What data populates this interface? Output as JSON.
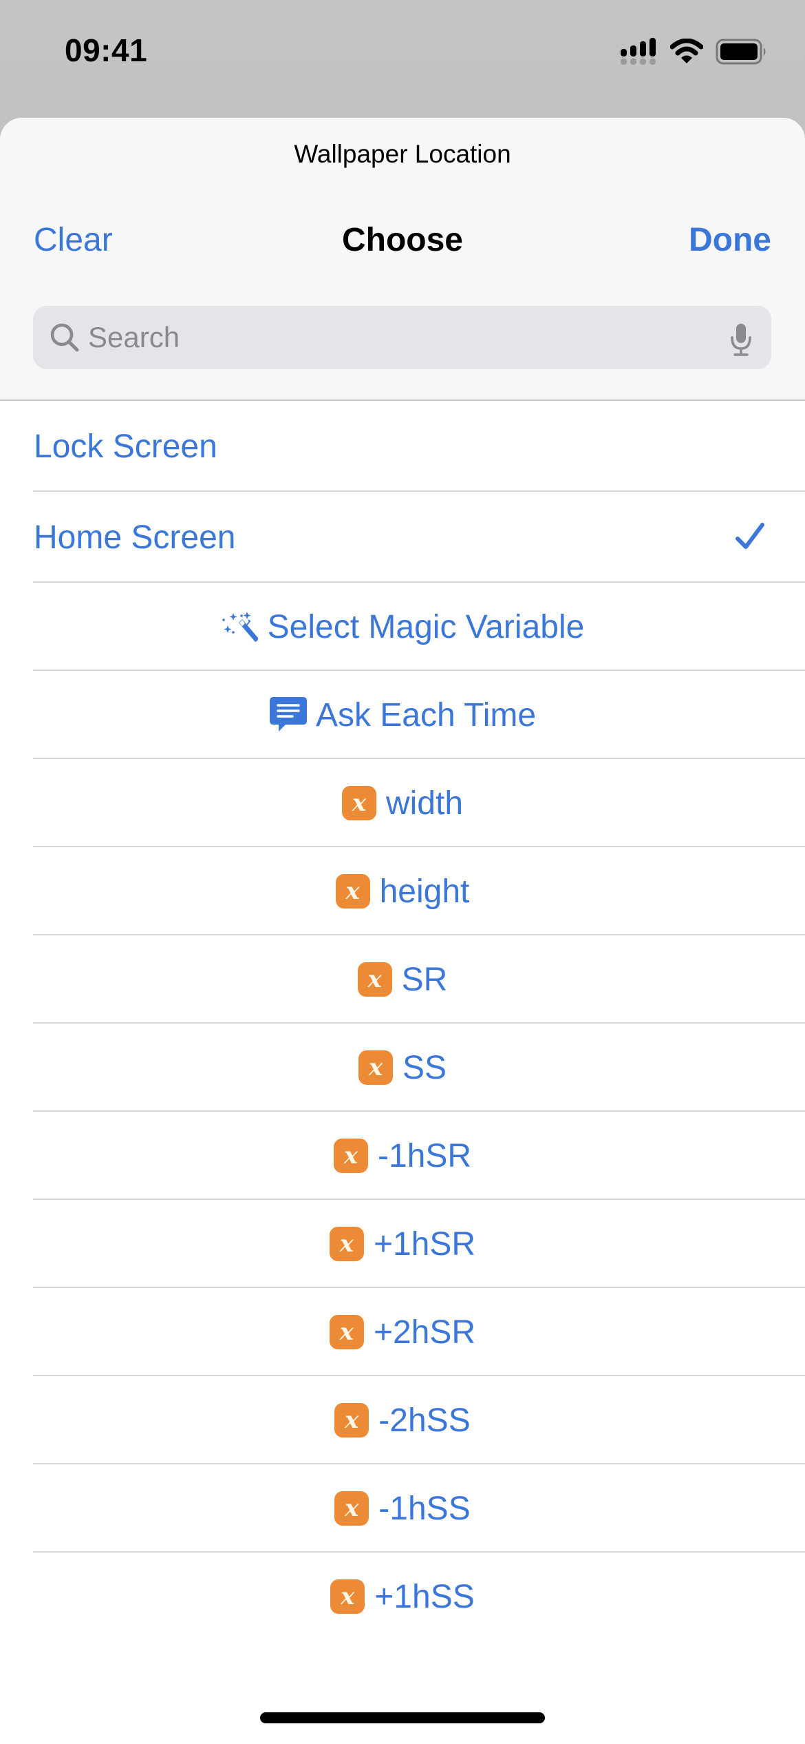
{
  "status_bar": {
    "time": "09:41",
    "icons": [
      "cellular-signal-icon",
      "wifi-icon",
      "battery-icon"
    ]
  },
  "sheet": {
    "subtitle": "Wallpaper Location",
    "nav": {
      "clear_label": "Clear",
      "title": "Choose",
      "done_label": "Done"
    },
    "search": {
      "placeholder": "Search",
      "value": ""
    }
  },
  "options": [
    {
      "label": "Lock Screen",
      "selected": false
    },
    {
      "label": "Home Screen",
      "selected": true
    }
  ],
  "actions": [
    {
      "label": "Select Magic Variable",
      "icon": "magic-wand-icon"
    },
    {
      "label": "Ask Each Time",
      "icon": "speech-bubble-icon"
    }
  ],
  "variables": [
    {
      "badge": "x",
      "label": "width"
    },
    {
      "badge": "x",
      "label": "height"
    },
    {
      "badge": "x",
      "label": "SR"
    },
    {
      "badge": "x",
      "label": "SS"
    },
    {
      "badge": "x",
      "label": "-1hSR"
    },
    {
      "badge": "x",
      "label": "+1hSR"
    },
    {
      "badge": "x",
      "label": "+2hSR"
    },
    {
      "badge": "x",
      "label": "-2hSS"
    },
    {
      "badge": "x",
      "label": "-1hSS"
    },
    {
      "badge": "x",
      "label": "+1hSS"
    }
  ],
  "colors": {
    "accent_blue": "#3a77d9",
    "variable_orange": "#ec8a35",
    "backdrop_gray": "#b9bab8",
    "header_bg": "#f7f7f7"
  }
}
